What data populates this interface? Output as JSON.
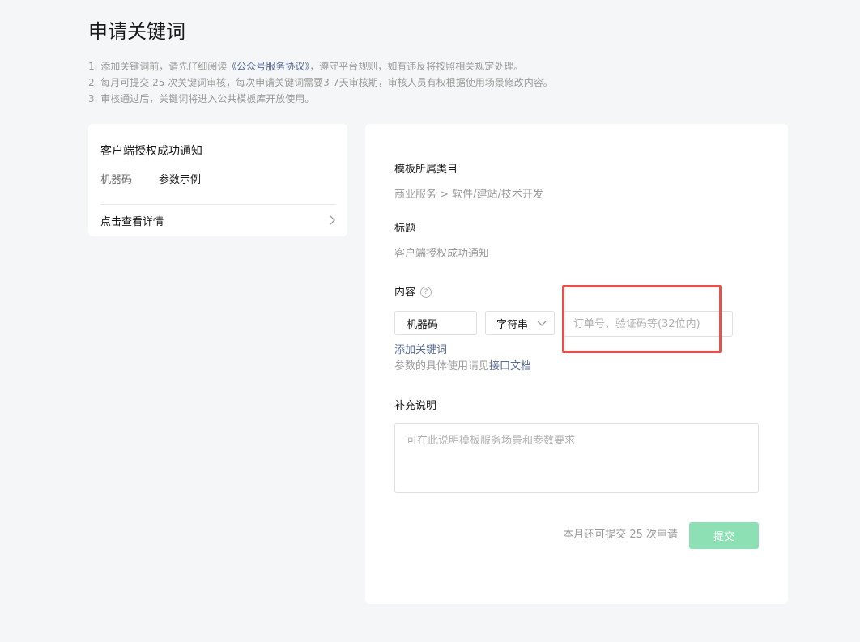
{
  "page": {
    "title": "申请关键词"
  },
  "notes": {
    "line1_prefix": "1. 添加关键词前，请先仔细阅读",
    "line1_link": "《公众号服务协议》",
    "line1_suffix": "，遵守平台规则，如有违反将按照相关规定处理。",
    "line2": "2. 每月可提交 25 次关键词审核，每次申请关键词需要3-7天审核期，审核人员有权根据使用场景修改内容。",
    "line3": "3. 审核通过后，关键词将进入公共模板库开放使用。"
  },
  "preview": {
    "title": "客户端授权成功通知",
    "field_name": "机器码",
    "field_value": "参数示例",
    "detail_label": "点击查看详情",
    "detail_icon": "chevron-right-icon"
  },
  "form": {
    "category_label": "模板所属类目",
    "category_value": "商业服务 > 软件/建站/技术开发",
    "title_label": "标题",
    "title_value": "客户端授权成功通知",
    "content_label": "内容",
    "content_help_icon": "question-icon",
    "keyword_value": "机器码",
    "type_value": "字符串",
    "example_placeholder": "订单号、验证码等(32位内)",
    "add_keyword": "添加关键词",
    "param_hint_prefix": "参数的具体使用请见",
    "param_hint_link": "接口文档",
    "desc_label": "补充说明",
    "desc_placeholder": "可在此说明模板服务场景和参数要求",
    "quota_text": "本月还可提交 25 次申请",
    "submit_label": "提交"
  },
  "colors": {
    "background": "#f5f6f8",
    "link": "#576b95",
    "submit_disabled": "#8ce0b4",
    "highlight": "#e6514b"
  }
}
